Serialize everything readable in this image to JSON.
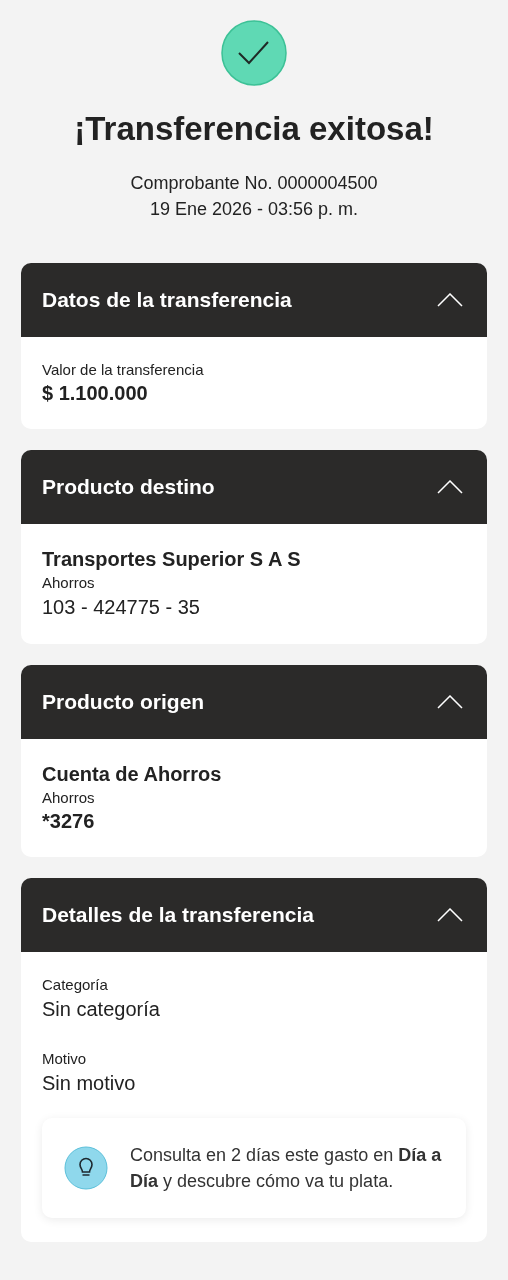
{
  "status": {
    "title": "¡Transferencia exitosa!",
    "receipt": "Comprobante No. 0000004500",
    "datetime": "19 Ene 2026 - 03:56 p. m."
  },
  "sections": [
    {
      "title": "Datos de la transferencia",
      "expanded": true,
      "groups": [
        {
          "fields": [
            {
              "kind": "label",
              "text": "Valor de la transferencia"
            },
            {
              "kind": "amount",
              "text": "$ 1.100.000"
            }
          ]
        }
      ]
    },
    {
      "title": "Producto destino",
      "expanded": true,
      "groups": [
        {
          "fields": [
            {
              "kind": "title",
              "text": "Transportes Superior S A S"
            },
            {
              "kind": "label",
              "text": "Ahorros"
            },
            {
              "kind": "value",
              "text": "103 - 424775 - 35"
            }
          ]
        }
      ]
    },
    {
      "title": "Producto origen",
      "expanded": true,
      "groups": [
        {
          "fields": [
            {
              "kind": "title",
              "text": "Cuenta de Ahorros"
            },
            {
              "kind": "label",
              "text": "Ahorros"
            },
            {
              "kind": "amount",
              "text": "*3276"
            }
          ]
        }
      ]
    },
    {
      "title": "Detalles de la transferencia",
      "expanded": true,
      "groups": [
        {
          "fields": [
            {
              "kind": "label",
              "text": "Categoría"
            },
            {
              "kind": "value",
              "text": "Sin categoría"
            }
          ]
        },
        {
          "fields": [
            {
              "kind": "label",
              "text": "Motivo"
            },
            {
              "kind": "value",
              "text": "Sin motivo"
            }
          ]
        }
      ],
      "tip": {
        "text": "Consulta en 2 días este gasto en **Día a Día** y descubre cómo va tu plata."
      }
    }
  ]
}
